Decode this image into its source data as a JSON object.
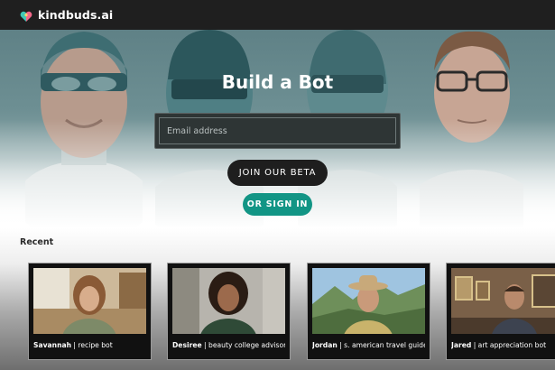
{
  "app": {
    "brand": "kindbuds.ai",
    "logo_icon": "heart-icon",
    "logo_colors": [
      "#3fc7b7",
      "#f2688a",
      "#ffd36b"
    ]
  },
  "hero": {
    "title": "Build a Bot",
    "email_placeholder": "Email address",
    "email_value": "",
    "join_label": "JOIN OUR BETA",
    "signin_label": "OR SIGN IN"
  },
  "recent": {
    "heading": "Recent",
    "items": [
      {
        "name": "Savannah",
        "separator": " | ",
        "role": "recipe bot",
        "scene": "kitchen"
      },
      {
        "name": "Desiree",
        "separator": " | ",
        "role": "beauty college advisor",
        "scene": "salon"
      },
      {
        "name": "Jordan",
        "separator": " | ",
        "role": "s. american travel guide",
        "scene": "mountains"
      },
      {
        "name": "Jared",
        "separator": " | ",
        "role": "art appreciation bot",
        "scene": "gallery"
      }
    ]
  },
  "colors": {
    "topbar": "#1f1f1f",
    "join_button": "#1e1e1e",
    "signin_button": "#129585"
  }
}
